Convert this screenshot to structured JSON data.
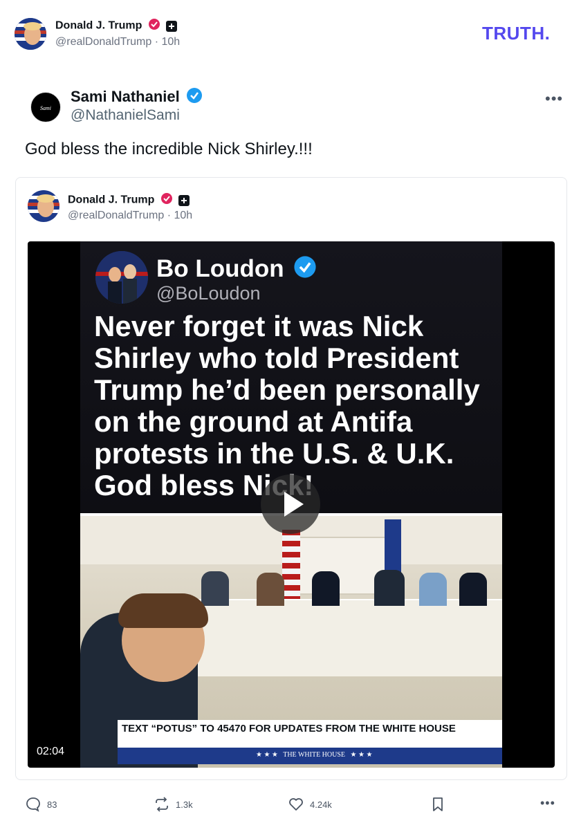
{
  "header": {
    "author_name": "Donald J. Trump",
    "author_handle": "@realDonaldTrump",
    "time_ago": "10h",
    "brand_logo": "TRUTH."
  },
  "embedded_post": {
    "author_name": "Sami Nathaniel",
    "author_handle": "@NathanielSami",
    "text": "God bless the incredible Nick Shirley.!!!"
  },
  "quoted_post": {
    "author_name": "Donald J. Trump",
    "author_handle": "@realDonaldTrump",
    "time_ago": "10h",
    "video": {
      "overlay_name": "Bo Loudon",
      "overlay_handle": "@BoLoudon",
      "overlay_text": "Never forget it was Nick Shirley who told President Trump he’d been personally on the ground at Antifa protests in the U.S. & U.K. God bless Nick!",
      "ticker_text": "TEXT “POTUS” TO 45470 FOR UPDATES FROM THE WHITE HOUSE",
      "ticker_sub": "★ ★ ★   THE WHITE HOUSE   ★ ★ ★",
      "duration": "02:04"
    }
  },
  "actions": {
    "replies": "83",
    "reposts": "1.3k",
    "likes": "4.24k"
  },
  "colors": {
    "brand": "#5448ee",
    "verified_blue": "#1d9bf0",
    "verified_red": "#e0245e"
  }
}
